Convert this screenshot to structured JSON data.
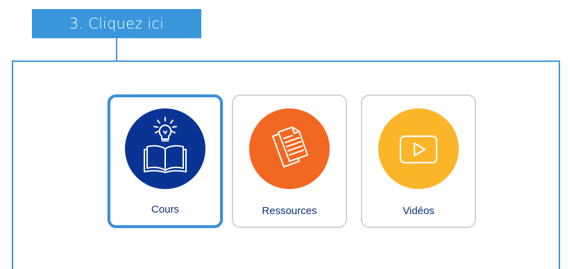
{
  "callout": {
    "label": "3. Cliquez ici"
  },
  "cards": [
    {
      "label": "Cours",
      "icon": "open-book-lightbulb-icon",
      "color": "#0a3494",
      "selected": true
    },
    {
      "label": "Ressources",
      "icon": "documents-icon",
      "color": "#f26722",
      "selected": false
    },
    {
      "label": "Vidéos",
      "icon": "video-play-icon",
      "color": "#fbb529",
      "selected": false
    }
  ],
  "colors": {
    "accent": "#3a96db",
    "card_border": "#cfd3d7",
    "label_text": "#0a2d7a"
  }
}
